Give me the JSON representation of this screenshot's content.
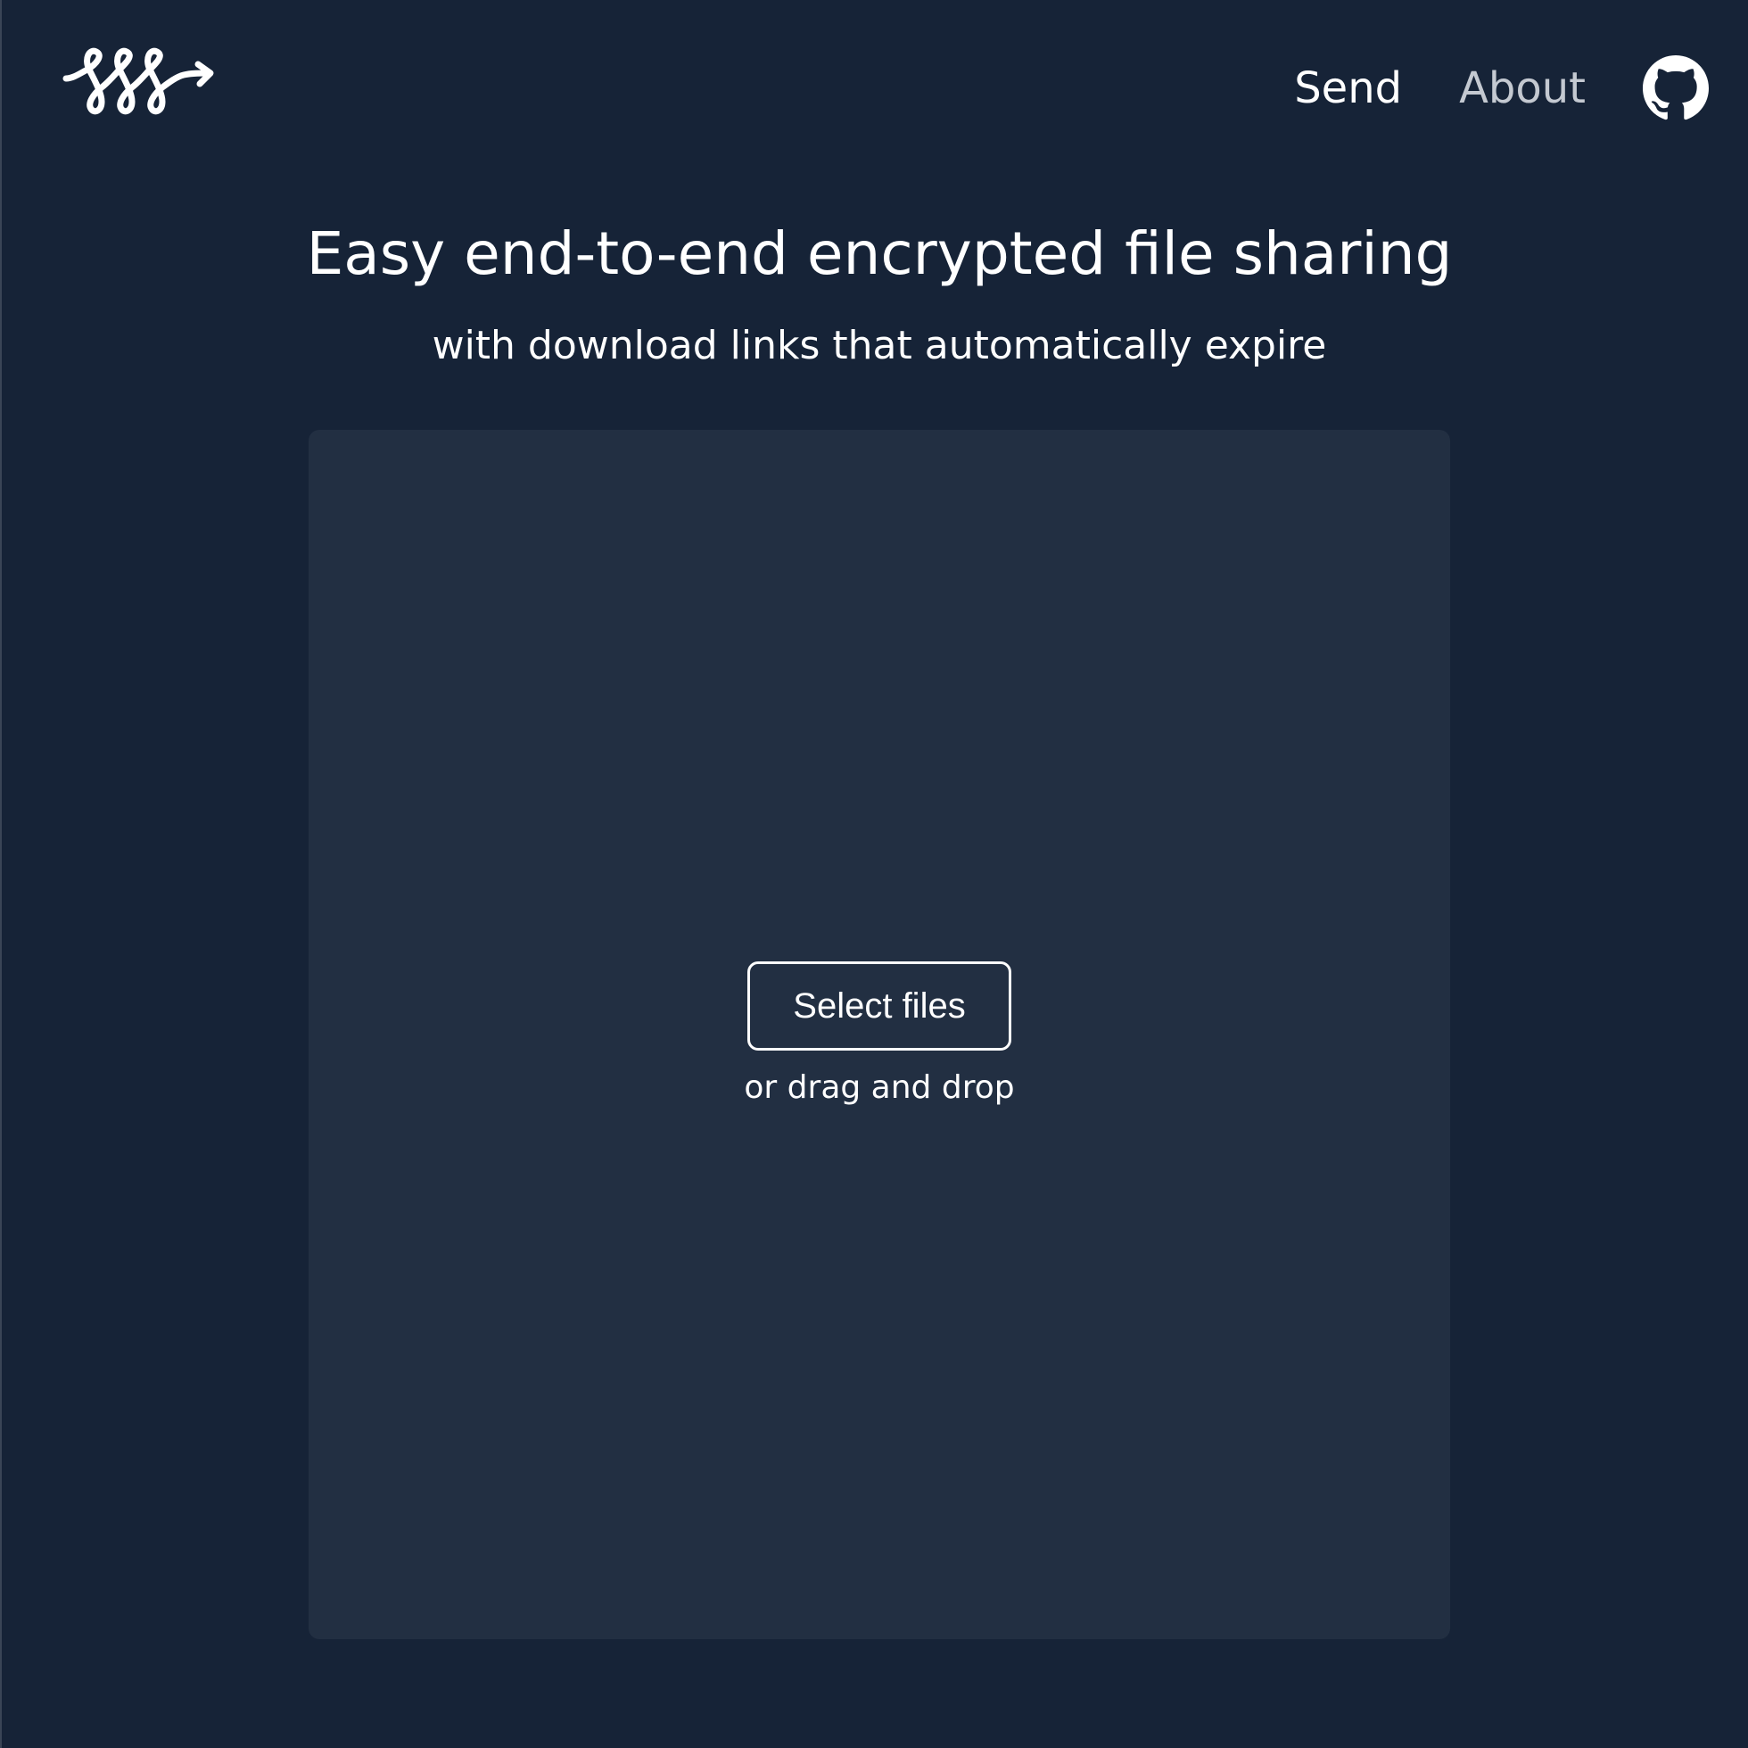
{
  "header": {
    "logo_icon": "send-squiggle-logo",
    "nav": {
      "send_label": "Send",
      "about_label": "About",
      "github_icon": "github-icon"
    }
  },
  "hero": {
    "title": "Easy end-to-end encrypted file sharing",
    "subtitle": "with download links that automatically expire"
  },
  "dropzone": {
    "button_label": "Select files",
    "hint": "or drag and drop"
  },
  "colors": {
    "background": "#162337",
    "panel": "#222f42",
    "text": "#ffffff",
    "muted_link": "#c4c9d1"
  }
}
